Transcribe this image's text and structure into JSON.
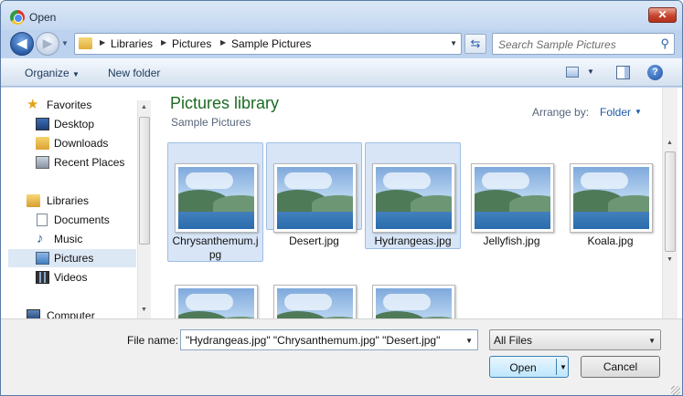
{
  "window": {
    "title": "Open",
    "close_glyph": "✕"
  },
  "nav": {
    "back_glyph": "◀",
    "forward_glyph": "▶",
    "breadcrumbs": [
      "Libraries",
      "Pictures",
      "Sample Pictures"
    ],
    "search_placeholder": "Search Sample Pictures"
  },
  "toolbar": {
    "organize_label": "Organize",
    "new_folder_label": "New folder"
  },
  "sidebar": {
    "items": [
      {
        "label": "Favorites",
        "icon": "star-icon"
      },
      {
        "label": "Desktop",
        "icon": "desktop-icon"
      },
      {
        "label": "Downloads",
        "icon": "downloads-icon"
      },
      {
        "label": "Recent Places",
        "icon": "recent-places-icon"
      },
      {
        "label": "Libraries",
        "icon": "libraries-icon"
      },
      {
        "label": "Documents",
        "icon": "documents-icon"
      },
      {
        "label": "Music",
        "icon": "music-icon"
      },
      {
        "label": "Pictures",
        "icon": "pictures-icon",
        "selected": true
      },
      {
        "label": "Videos",
        "icon": "videos-icon"
      },
      {
        "label": "Computer",
        "icon": "computer-icon"
      }
    ]
  },
  "main": {
    "library_title": "Pictures library",
    "library_subtitle": "Sample Pictures",
    "arrange_label": "Arrange by:",
    "arrange_value": "Folder",
    "files": [
      {
        "name": "Chrysanthemum.jpg",
        "selected": true
      },
      {
        "name": "Desert.jpg",
        "selected": true
      },
      {
        "name": "Hydrangeas.jpg",
        "selected": true
      },
      {
        "name": "Jellyfish.jpg",
        "selected": false
      },
      {
        "name": "Koala.jpg",
        "selected": false
      },
      {
        "name": "",
        "selected": false
      },
      {
        "name": "",
        "selected": false
      },
      {
        "name": "",
        "selected": false
      }
    ]
  },
  "footer": {
    "file_name_label": "File name:",
    "file_name_value": "\"Hydrangeas.jpg\" \"Chrysanthemum.jpg\" \"Desert.jpg\"",
    "file_type_value": "All Files",
    "open_label": "Open",
    "cancel_label": "Cancel"
  },
  "colors": {
    "accent": "#1e5aa8",
    "library_title": "#1c6b21",
    "selection": "#d7e5f7"
  }
}
